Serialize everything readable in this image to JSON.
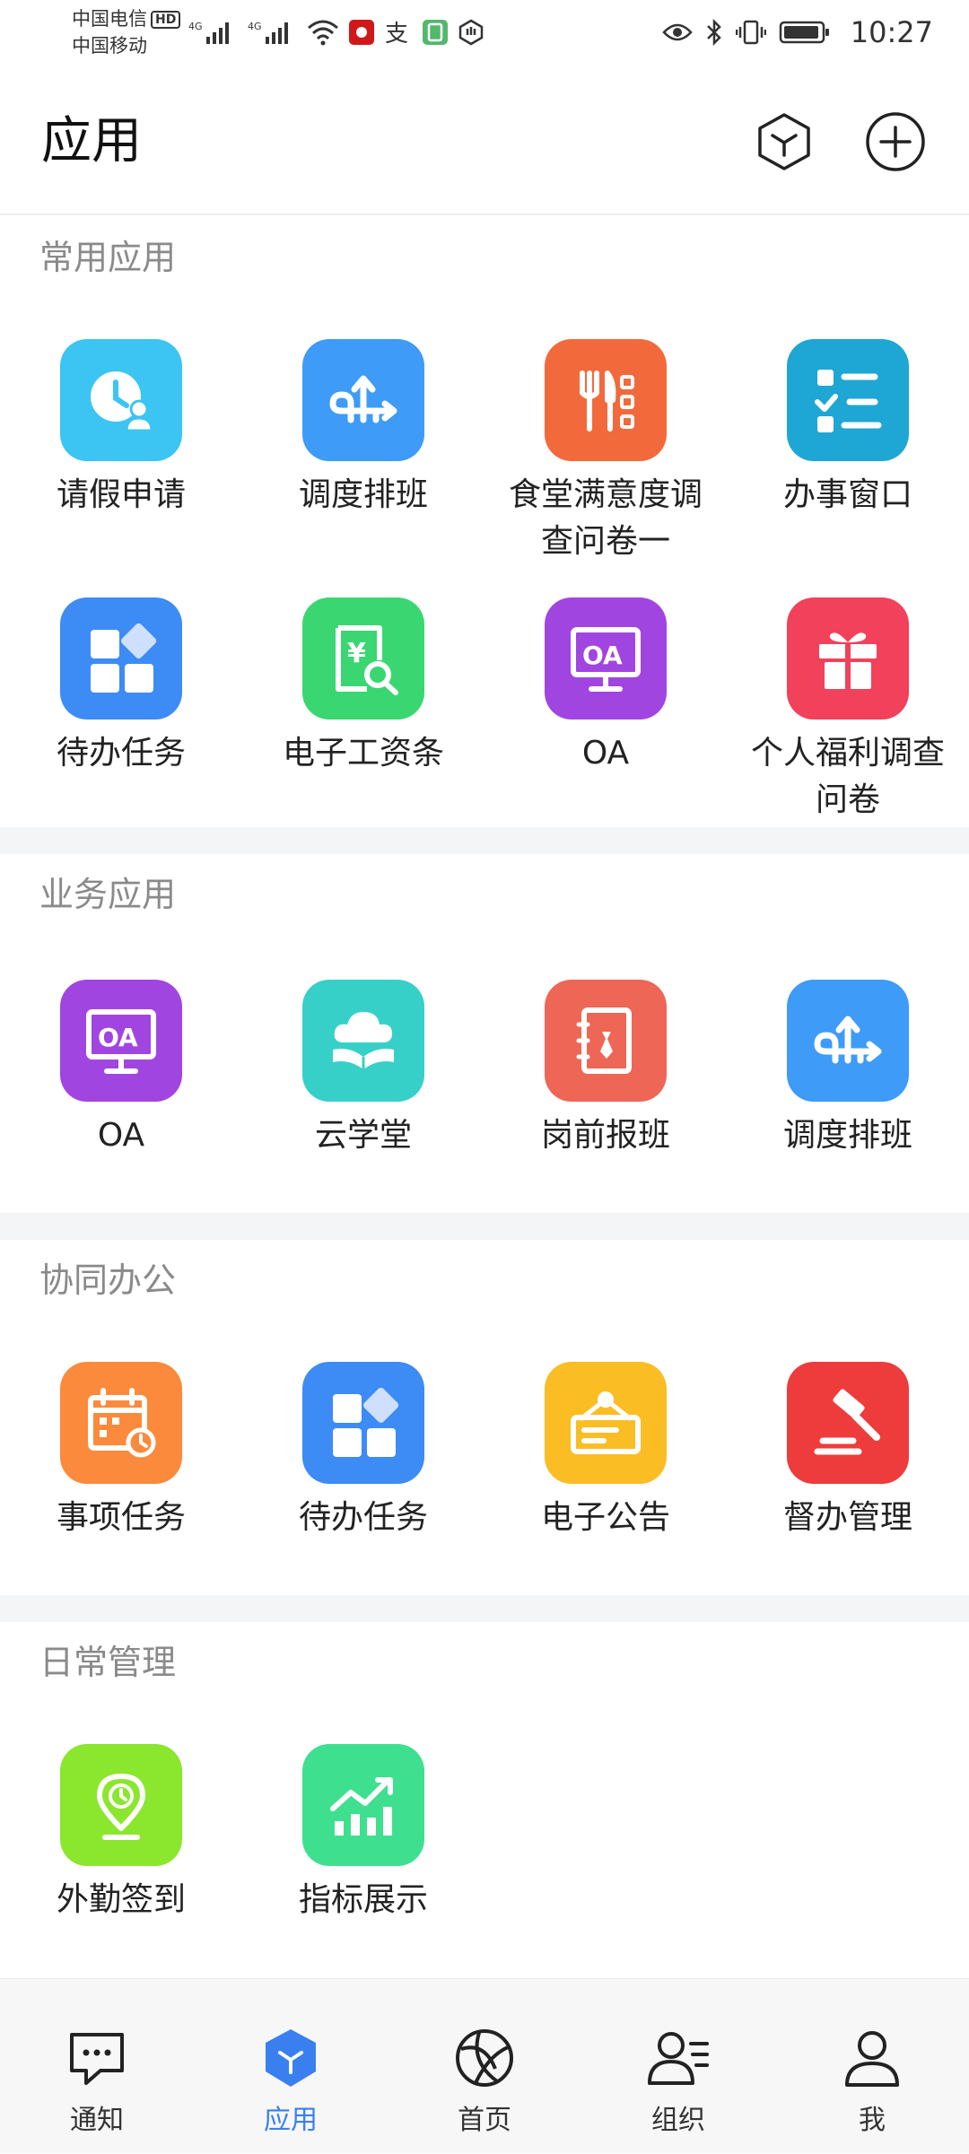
{
  "status": {
    "carrier1": "中国电信",
    "hd": "HD",
    "carrier2": "中国移动",
    "time": "10:27"
  },
  "header": {
    "title": "应用"
  },
  "sections": [
    {
      "title": "常用应用",
      "apps": [
        {
          "label": "请假申请",
          "color": "#3cc4f2",
          "icon": "clock-person-icon"
        },
        {
          "label": "调度排班",
          "color": "#3e9bf7",
          "icon": "route-arrows-icon"
        },
        {
          "label": "食堂满意度调查问卷一",
          "color": "#f26a3b",
          "icon": "fork-knife-list-icon"
        },
        {
          "label": "办事窗口",
          "color": "#1ea6d4",
          "icon": "checklist-icon"
        },
        {
          "label": "待办任务",
          "color": "#3d8bf5",
          "icon": "grid-diamond-icon"
        },
        {
          "label": "电子工资条",
          "color": "#3ad672",
          "icon": "salary-search-icon"
        },
        {
          "label": "OA",
          "color": "#a145e0",
          "icon": "oa-monitor-icon"
        },
        {
          "label": "个人福利调查问卷",
          "color": "#f2415a",
          "icon": "gift-icon"
        }
      ]
    },
    {
      "title": "业务应用",
      "apps": [
        {
          "label": "OA",
          "color": "#a145e0",
          "icon": "oa-monitor-icon"
        },
        {
          "label": "云学堂",
          "color": "#37d0c8",
          "icon": "cloud-book-icon"
        },
        {
          "label": "岗前报班",
          "color": "#ee6656",
          "icon": "badge-card-icon"
        },
        {
          "label": "调度排班",
          "color": "#3e9bf7",
          "icon": "route-arrows-icon"
        }
      ]
    },
    {
      "title": "协同办公",
      "apps": [
        {
          "label": "事项任务",
          "color": "#fb8a3c",
          "icon": "calendar-clock-icon"
        },
        {
          "label": "待办任务",
          "color": "#3d8bf5",
          "icon": "grid-diamond-icon"
        },
        {
          "label": "电子公告",
          "color": "#fbbd24",
          "icon": "notice-board-icon"
        },
        {
          "label": "督办管理",
          "color": "#ee3b3b",
          "icon": "gavel-icon"
        }
      ]
    },
    {
      "title": "日常管理",
      "apps": [
        {
          "label": "外勤签到",
          "color": "#8be62e",
          "icon": "location-clock-icon"
        },
        {
          "label": "指标展示",
          "color": "#3ee08f",
          "icon": "chart-trend-icon"
        }
      ]
    }
  ],
  "nav": [
    {
      "label": "通知",
      "icon": "chat-bubble-icon"
    },
    {
      "label": "应用",
      "icon": "app-hexagon-icon",
      "active": true
    },
    {
      "label": "首页",
      "icon": "globe-ball-icon"
    },
    {
      "label": "组织",
      "icon": "org-user-list-icon"
    },
    {
      "label": "我",
      "icon": "user-icon"
    }
  ],
  "colors": {
    "accent": "#3a7ff0",
    "section_title": "#8a8a8a"
  }
}
